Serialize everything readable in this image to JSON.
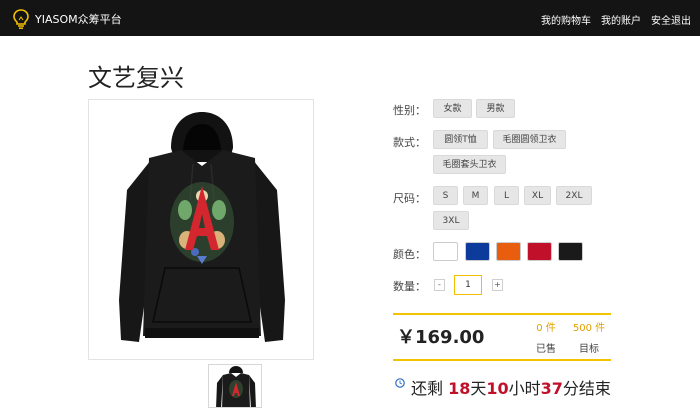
{
  "header": {
    "brand": "YIASOM众筹平台",
    "nav": [
      "我的购物车",
      "我的账户",
      "安全退出"
    ]
  },
  "product": {
    "title": "文艺复兴"
  },
  "options": {
    "gender": {
      "label": "性别：",
      "values": [
        "女款",
        "男款"
      ]
    },
    "style": {
      "label": "款式：",
      "values": [
        "圆领T恤",
        "毛圈圆领卫衣",
        "毛圈套头卫衣"
      ]
    },
    "size": {
      "label": "尺码：",
      "values": [
        "S",
        "M",
        "L",
        "XL",
        "2XL",
        "3XL"
      ]
    },
    "color": {
      "label": "颜色：",
      "swatches": [
        "#ffffff",
        "#0d3b9c",
        "#e85d0e",
        "#c0102a",
        "#1a1a1a"
      ]
    },
    "quantity": {
      "label": "数量：",
      "minus": "-",
      "value": "1",
      "plus": "+"
    }
  },
  "pricing": {
    "price": "￥169.00",
    "sold_value": "0 件",
    "sold_label": "已售",
    "target_value": "500 件",
    "target_label": "目标"
  },
  "countdown": {
    "prefix": "还剩 ",
    "days": "18",
    "days_unit": "天",
    "hours": "10",
    "hours_unit": "小时",
    "minutes": "37",
    "minutes_unit": "分结束"
  },
  "colors": {
    "accent": "#f5c400",
    "highlight": "#c0102a",
    "header_bg": "#141414"
  }
}
